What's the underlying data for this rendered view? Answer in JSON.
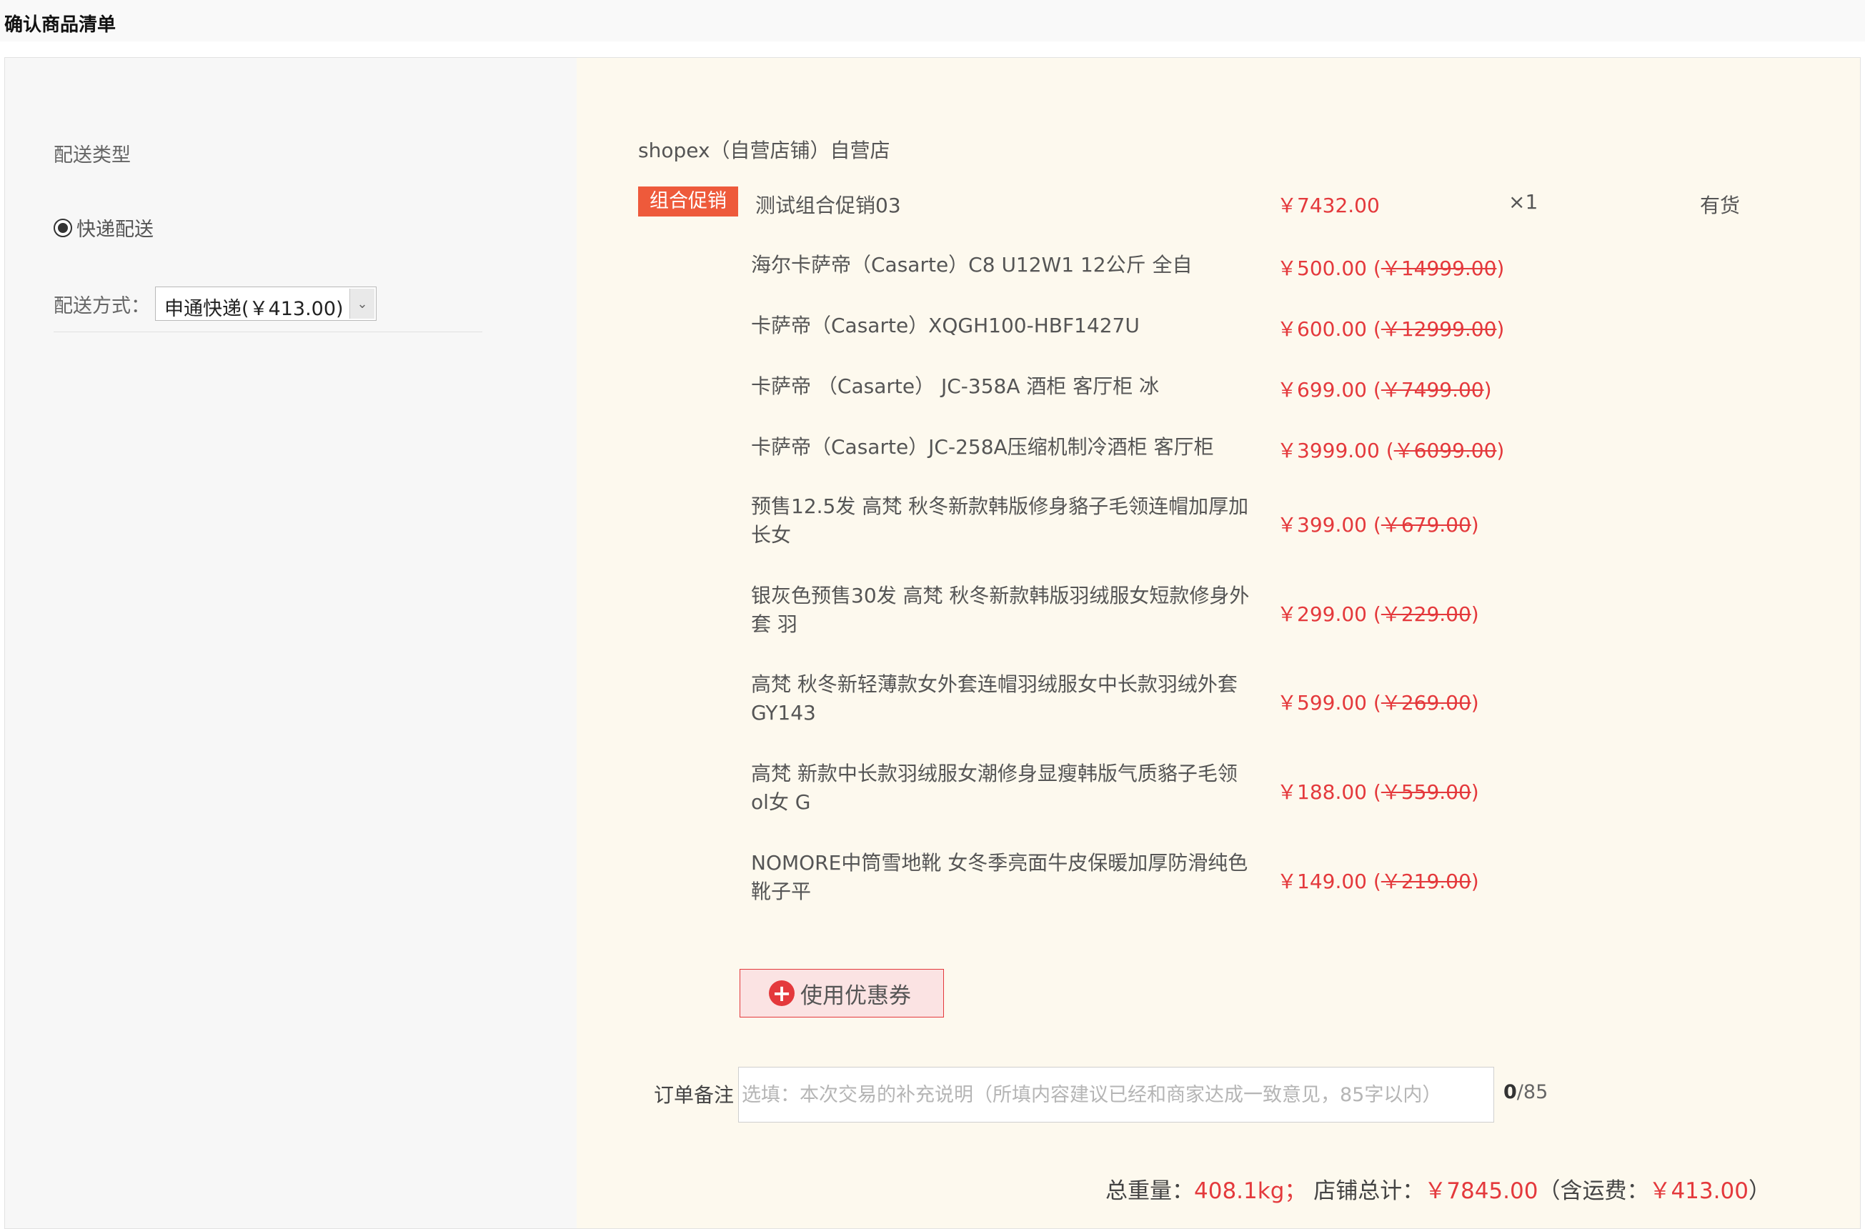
{
  "page": {
    "title": "确认商品清单"
  },
  "delivery": {
    "type_label": "配送类型",
    "type_option": "快递配送",
    "method_label": "配送方式：",
    "method_selected": "申通快递(￥413.00)"
  },
  "shop": {
    "name": "shopex（自营店铺）自营店"
  },
  "promotion": {
    "badge": "组合促销",
    "name": "测试组合促销03",
    "price": "￥7432.00",
    "quantity": "×1",
    "stock": "有货"
  },
  "items": [
    {
      "name": "海尔卡萨帝（Casarte）C8 U12W1 12公斤 全自",
      "price": "￥500.00",
      "original_price": "￥14999.00"
    },
    {
      "name": "卡萨帝（Casarte）XQGH100-HBF1427U",
      "price": "￥600.00",
      "original_price": "￥12999.00"
    },
    {
      "name": "卡萨帝 （Casarte） JC-358A 酒柜 客厅柜 冰",
      "price": "￥699.00",
      "original_price": "￥7499.00"
    },
    {
      "name": "卡萨帝（Casarte）JC-258A压缩机制冷酒柜 客厅柜",
      "price": "￥3999.00",
      "original_price": "￥6099.00"
    },
    {
      "name": "预售12.5发 高梵 秋冬新款韩版修身貉子毛领连帽加厚加长女",
      "price": "￥399.00",
      "original_price": "￥679.00"
    },
    {
      "name": "银灰色预售30发 高梵 秋冬新款韩版羽绒服女短款修身外套 羽",
      "price": "￥299.00",
      "original_price": "￥229.00"
    },
    {
      "name": "高梵 秋冬新轻薄款女外套连帽羽绒服女中长款羽绒外套GY143",
      "price": "￥599.00",
      "original_price": "￥269.00"
    },
    {
      "name": "高梵 新款中长款羽绒服女潮修身显瘦韩版气质貉子毛领ol女 G",
      "price": "￥188.00",
      "original_price": "￥559.00"
    },
    {
      "name": "NOMORE中筒雪地靴 女冬季亮面牛皮保暖加厚防滑纯色靴子平",
      "price": "￥149.00",
      "original_price": "￥219.00"
    }
  ],
  "coupon": {
    "label": "使用优惠券",
    "icon": "plus-circle-icon"
  },
  "remark": {
    "label": "订单备注",
    "placeholder": "选填：本次交易的补充说明（所填内容建议已经和商家达成一致意见，85字以内）",
    "value": "",
    "count": "0",
    "max": "/85"
  },
  "summary": {
    "weight_label": "总重量：",
    "weight_value": "408.1kg",
    "sep": "；",
    "total_label": "店铺总计：",
    "total_value": "￥7845.00",
    "shipping_open": "（含运费：",
    "shipping_value": "￥413.00",
    "shipping_close": "）"
  },
  "colors": {
    "accent_red": "#e4393c",
    "promo_badge": "#ee5a3b",
    "right_panel_bg": "#fdf9ee"
  }
}
